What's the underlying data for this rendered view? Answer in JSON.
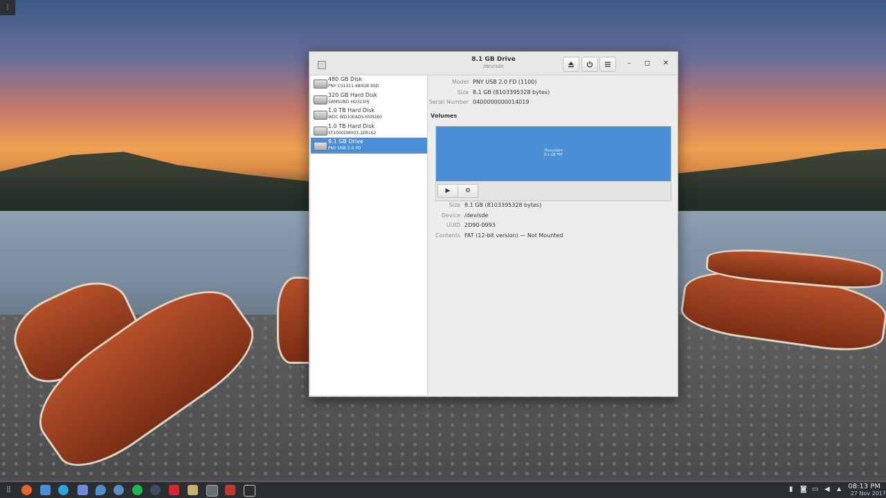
{
  "window": {
    "title": "8.1 GB Drive",
    "subtitle": "/dev/sde",
    "buttons": {
      "eject_icon": "eject-icon",
      "power_icon": "power-icon",
      "menu_icon": "menu-icon",
      "minimize": "–",
      "maximize": "◻",
      "close": "✕"
    }
  },
  "sidebar": {
    "disks": [
      {
        "name": "480 GB Disk",
        "sub": "PNY CS1311 480GB SSD",
        "selected": false
      },
      {
        "name": "320 GB Hard Disk",
        "sub": "SAMSUNG HD321HJ",
        "selected": false
      },
      {
        "name": "1.0 TB Hard Disk",
        "sub": "WDC WD10EADS-65M2B0",
        "selected": false
      },
      {
        "name": "1.0 TB Hard Disk",
        "sub": "ST1000DM003-1ER162",
        "selected": false
      },
      {
        "name": "8.1 GB Drive",
        "sub": "PNY USB 2.0 FD",
        "selected": true
      }
    ]
  },
  "drive": {
    "model_label": "Model",
    "model": "PNY USB 2.0 FD (1100)",
    "size_label": "Size",
    "size": "8.1 GB (8103395328 bytes)",
    "serial_label": "Serial Number",
    "serial": "0400000000014019"
  },
  "volumes": {
    "heading": "Volumes",
    "bar_line1": "Filesystem",
    "bar_line2": "8.1 GB FAT",
    "play_icon": "▶",
    "settings_icon": "⚙"
  },
  "volume": {
    "size_label": "Size",
    "size": "8.1 GB (8103395328 bytes)",
    "device_label": "Device",
    "device": "/dev/sde",
    "uuid_label": "UUID",
    "uuid": "2D90-0993",
    "contents_label": "Contents",
    "contents": "FAT (12-bit version) — Not Mounted"
  },
  "taskbar": {
    "time": "08:13 PM",
    "date": "27 Nov 2017",
    "tray_expand": "▲"
  },
  "colors": {
    "accent": "#4a90d9",
    "taskbar": "#2b2e31"
  }
}
